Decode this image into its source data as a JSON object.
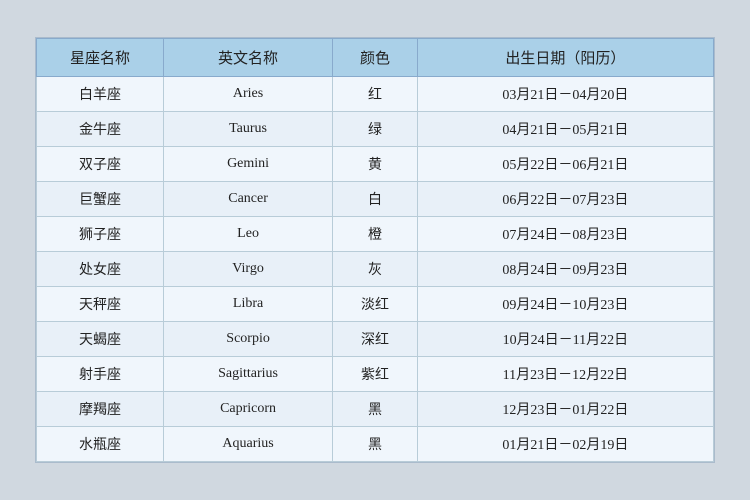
{
  "table": {
    "headers": {
      "chinese_name": "星座名称",
      "english_name": "英文名称",
      "color": "颜色",
      "birthday": "出生日期（阳历）"
    },
    "rows": [
      {
        "chinese": "白羊座",
        "english": "Aries",
        "color": "红",
        "date": "03月21日－04月20日"
      },
      {
        "chinese": "金牛座",
        "english": "Taurus",
        "color": "绿",
        "date": "04月21日－05月21日"
      },
      {
        "chinese": "双子座",
        "english": "Gemini",
        "color": "黄",
        "date": "05月22日－06月21日"
      },
      {
        "chinese": "巨蟹座",
        "english": "Cancer",
        "color": "白",
        "date": "06月22日－07月23日"
      },
      {
        "chinese": "狮子座",
        "english": "Leo",
        "color": "橙",
        "date": "07月24日－08月23日"
      },
      {
        "chinese": "处女座",
        "english": "Virgo",
        "color": "灰",
        "date": "08月24日－09月23日"
      },
      {
        "chinese": "天秤座",
        "english": "Libra",
        "color": "淡红",
        "date": "09月24日－10月23日"
      },
      {
        "chinese": "天蝎座",
        "english": "Scorpio",
        "color": "深红",
        "date": "10月24日－11月22日"
      },
      {
        "chinese": "射手座",
        "english": "Sagittarius",
        "color": "紫红",
        "date": "11月23日－12月22日"
      },
      {
        "chinese": "摩羯座",
        "english": "Capricorn",
        "color": "黑",
        "date": "12月23日－01月22日"
      },
      {
        "chinese": "水瓶座",
        "english": "Aquarius",
        "color": "黑",
        "date": "01月21日－02月19日"
      }
    ]
  }
}
